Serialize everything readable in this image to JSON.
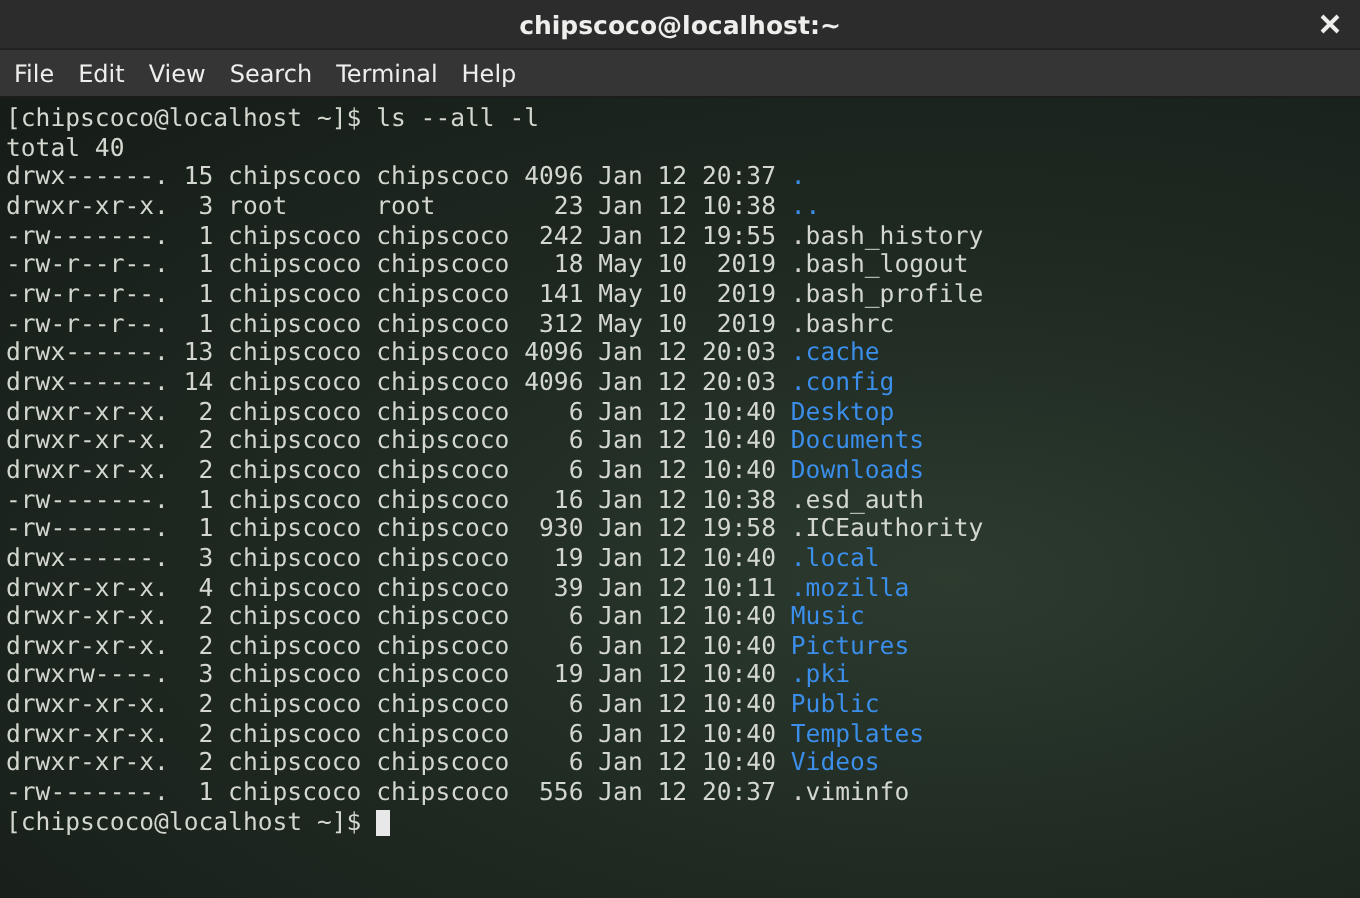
{
  "window": {
    "title": "chipscoco@localhost:~"
  },
  "menu": [
    "File",
    "Edit",
    "View",
    "Search",
    "Terminal",
    "Help"
  ],
  "terminal": {
    "command_line": "[chipscoco@localhost ~]$ ls --all -l",
    "total": "total 40",
    "entries": [
      {
        "info": "drwx------. 15 chipscoco chipscoco 4096 Jan 12 20:37",
        "name": ".",
        "kind": "directory"
      },
      {
        "info": "drwxr-xr-x.  3 root      root        23 Jan 12 10:38",
        "name": "..",
        "kind": "directory"
      },
      {
        "info": "-rw-------.  1 chipscoco chipscoco  242 Jan 12 19:55",
        "name": ".bash_history",
        "kind": "file"
      },
      {
        "info": "-rw-r--r--.  1 chipscoco chipscoco   18 May 10  2019",
        "name": ".bash_logout",
        "kind": "file"
      },
      {
        "info": "-rw-r--r--.  1 chipscoco chipscoco  141 May 10  2019",
        "name": ".bash_profile",
        "kind": "file"
      },
      {
        "info": "-rw-r--r--.  1 chipscoco chipscoco  312 May 10  2019",
        "name": ".bashrc",
        "kind": "file"
      },
      {
        "info": "drwx------. 13 chipscoco chipscoco 4096 Jan 12 20:03",
        "name": ".cache",
        "kind": "directory"
      },
      {
        "info": "drwx------. 14 chipscoco chipscoco 4096 Jan 12 20:03",
        "name": ".config",
        "kind": "directory"
      },
      {
        "info": "drwxr-xr-x.  2 chipscoco chipscoco    6 Jan 12 10:40",
        "name": "Desktop",
        "kind": "directory"
      },
      {
        "info": "drwxr-xr-x.  2 chipscoco chipscoco    6 Jan 12 10:40",
        "name": "Documents",
        "kind": "directory"
      },
      {
        "info": "drwxr-xr-x.  2 chipscoco chipscoco    6 Jan 12 10:40",
        "name": "Downloads",
        "kind": "directory"
      },
      {
        "info": "-rw-------.  1 chipscoco chipscoco   16 Jan 12 10:38",
        "name": ".esd_auth",
        "kind": "file"
      },
      {
        "info": "-rw-------.  1 chipscoco chipscoco  930 Jan 12 19:58",
        "name": ".ICEauthority",
        "kind": "file"
      },
      {
        "info": "drwx------.  3 chipscoco chipscoco   19 Jan 12 10:40",
        "name": ".local",
        "kind": "directory"
      },
      {
        "info": "drwxr-xr-x.  4 chipscoco chipscoco   39 Jan 12 10:11",
        "name": ".mozilla",
        "kind": "directory"
      },
      {
        "info": "drwxr-xr-x.  2 chipscoco chipscoco    6 Jan 12 10:40",
        "name": "Music",
        "kind": "directory"
      },
      {
        "info": "drwxr-xr-x.  2 chipscoco chipscoco    6 Jan 12 10:40",
        "name": "Pictures",
        "kind": "directory"
      },
      {
        "info": "drwxrw----.  3 chipscoco chipscoco   19 Jan 12 10:40",
        "name": ".pki",
        "kind": "directory"
      },
      {
        "info": "drwxr-xr-x.  2 chipscoco chipscoco    6 Jan 12 10:40",
        "name": "Public",
        "kind": "directory"
      },
      {
        "info": "drwxr-xr-x.  2 chipscoco chipscoco    6 Jan 12 10:40",
        "name": "Templates",
        "kind": "directory"
      },
      {
        "info": "drwxr-xr-x.  2 chipscoco chipscoco    6 Jan 12 10:40",
        "name": "Videos",
        "kind": "directory"
      },
      {
        "info": "-rw-------.  1 chipscoco chipscoco  556 Jan 12 20:37",
        "name": ".viminfo",
        "kind": "file"
      }
    ],
    "prompt": "[chipscoco@localhost ~]$"
  }
}
